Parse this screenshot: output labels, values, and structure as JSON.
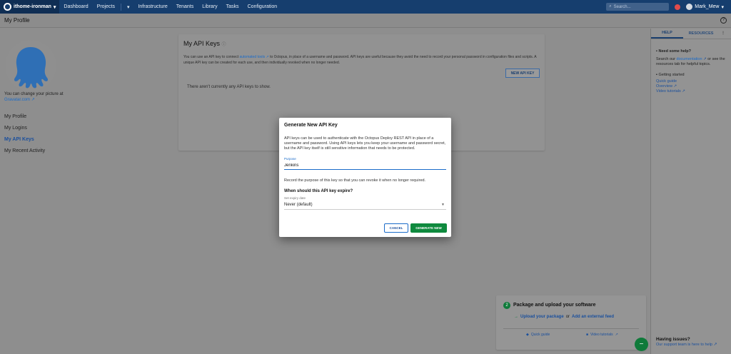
{
  "topnav": {
    "space_name": "ithome-ironman",
    "items": [
      "Dashboard",
      "Projects",
      "Infrastructure",
      "Tenants",
      "Library",
      "Tasks",
      "Configuration"
    ],
    "search_placeholder": "Search...",
    "user_name": "Mark_Mew"
  },
  "page": {
    "title": "My Profile"
  },
  "profile": {
    "picture_text": "You can change your picture at",
    "gravatar_link": "Gravatar.com",
    "nav": [
      "My Profile",
      "My Logins",
      "My API Keys",
      "My Recent Activity"
    ],
    "active_nav": "My API Keys"
  },
  "api_keys": {
    "title": "My API Keys",
    "description_pre": "You can use an API key to connect",
    "description_link": "automated tools",
    "description_post": "to Octopus, in place of a username and password. API keys are useful because they avoid the need to record your personal password in configuration files and scripts. A unique API key can be created for each use, and then individually revoked when no longer needed.",
    "new_button": "NEW API KEY",
    "empty_text": "There aren't currently any API keys to show."
  },
  "modal": {
    "title": "Generate New API Key",
    "description": "API keys can be used to authenticate with the Octopus Deploy REST API in place of a username and password. Using API keys lets you keep your username and password secret, but the API key itself is still sensitive information that needs to be protected.",
    "purpose_label": "Purpose",
    "purpose_value": "Jenkins",
    "purpose_hint": "Record the purpose of this key so that you can revoke it when no longer required.",
    "expiry_question": "When should this API key expire?",
    "expiry_label": "Set expiry date",
    "expiry_value": "Never (default)",
    "cancel_label": "CANCEL",
    "generate_label": "GENERATE NEW"
  },
  "help_panel": {
    "tab_help": "HELP",
    "tab_resources": "RESOURCES",
    "need_help_title": "Need some help?",
    "need_help_pre": "Search our",
    "documentation_link": "documentation",
    "need_help_post": "or see the resources tab for helpful topics.",
    "getting_started_title": "Getting started",
    "links": [
      "Quick guide",
      "Overview",
      "Video tutorials"
    ],
    "issues_title": "Having issues?",
    "issues_link": "Our support team is here to help"
  },
  "onboarding": {
    "step": "2",
    "title": "Package and upload your software",
    "upload_link": "Upload your package",
    "or_text": "or",
    "feed_link": "Add an external feed",
    "quick_guide": "Quick guide",
    "video_tutorials": "Video tutorials"
  },
  "colors": {
    "nav_bg": "#163e6e",
    "accent_blue": "#1a6bc9",
    "primary_green": "#0f8a3e",
    "octopus_blue": "#2f6fb5"
  }
}
